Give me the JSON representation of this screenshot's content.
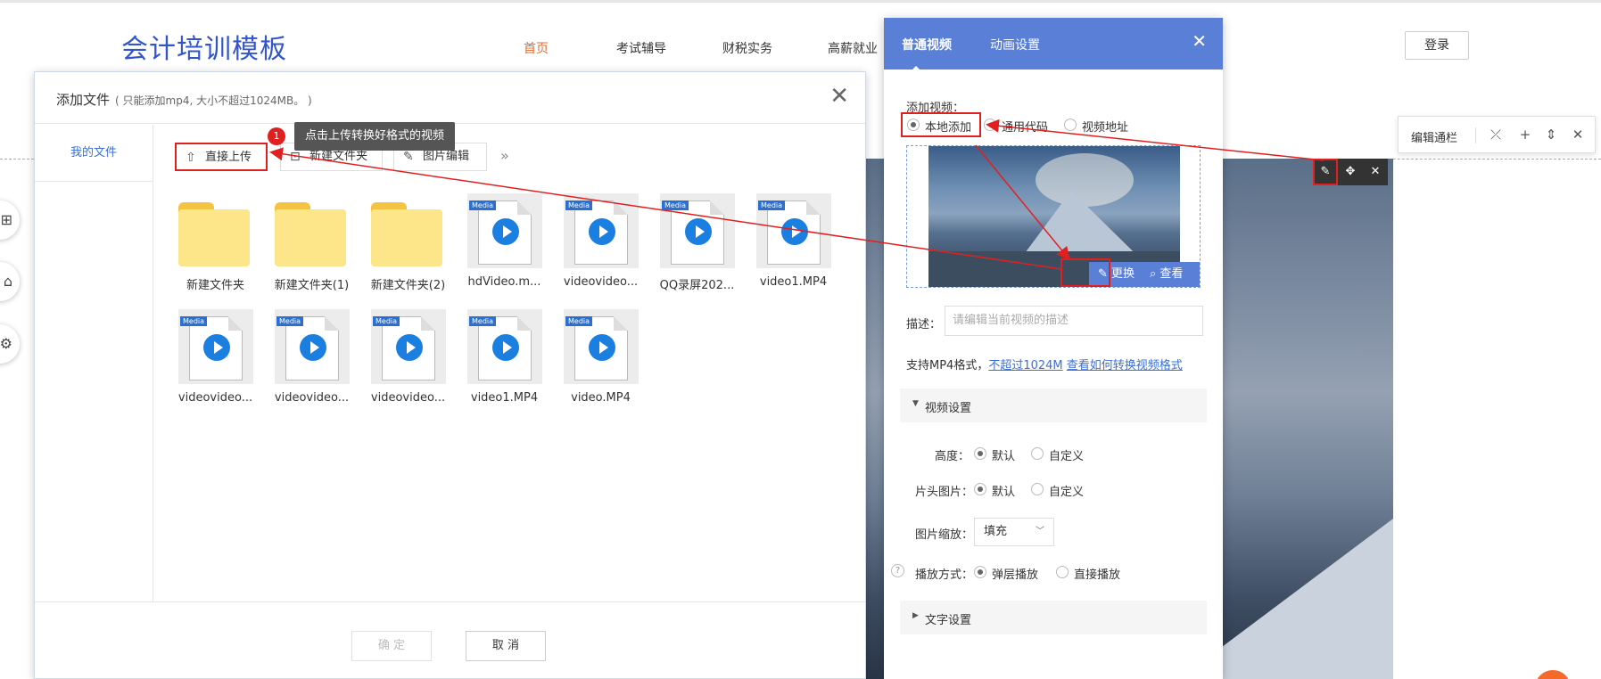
{
  "site": {
    "logo": "会计培训模板",
    "nav": [
      "首页",
      "考试辅导",
      "财税实务",
      "高薪就业"
    ],
    "login": "登录"
  },
  "edit_bar": {
    "label": "编辑通栏"
  },
  "file_dialog": {
    "title": "添加文件",
    "subtitle": "( 只能添加mp4, 大小不超过1024MB。 )",
    "sidebar_item": "我的文件",
    "toolbar": {
      "upload": "直接上传",
      "new_folder": "新建文件夹",
      "image_edit": "图片编辑"
    },
    "tip": {
      "badge": "1",
      "text": "点击上传转换好格式的视频"
    },
    "files": [
      {
        "name": "新建文件夹",
        "type": "folder"
      },
      {
        "name": "新建文件夹(1)",
        "type": "folder"
      },
      {
        "name": "新建文件夹(2)",
        "type": "folder"
      },
      {
        "name": "hdVideo.m...",
        "type": "media"
      },
      {
        "name": "videovideo...",
        "type": "media"
      },
      {
        "name": "QQ录屏202...",
        "type": "media"
      },
      {
        "name": "video1.MP4",
        "type": "media"
      },
      {
        "name": "videovideo...",
        "type": "media"
      },
      {
        "name": "videovideo...",
        "type": "media"
      },
      {
        "name": "videovideo...",
        "type": "media"
      },
      {
        "name": "video1.MP4",
        "type": "media"
      },
      {
        "name": "video.MP4",
        "type": "media"
      }
    ],
    "media_tag": "Media",
    "confirm": "确 定",
    "cancel": "取 消"
  },
  "video_panel": {
    "tabs": [
      "普通视频",
      "动画设置"
    ],
    "add_video_label": "添加视频：",
    "source_options": [
      "本地添加",
      "通用代码",
      "视频地址"
    ],
    "replace": "更换",
    "view": "查看",
    "desc_label": "描述：",
    "desc_placeholder": "请编辑当前视频的描述",
    "support_text": "支持MP4格式，",
    "support_link1": "不超过1024M",
    "support_link2": "查看如何转换视频格式",
    "video_settings": "视频设置",
    "height_label": "高度：",
    "cover_label": "片头图片：",
    "default": "默认",
    "custom": "自定义",
    "scale_label": "图片缩放：",
    "scale_value": "填充",
    "play_label": "播放方式：",
    "play_options": [
      "弹层播放",
      "直接播放"
    ],
    "text_settings": "文字设置"
  },
  "colors": {
    "accent": "#5a7fd6",
    "annotation": "#e02020",
    "nav_active": "#e8692b"
  }
}
